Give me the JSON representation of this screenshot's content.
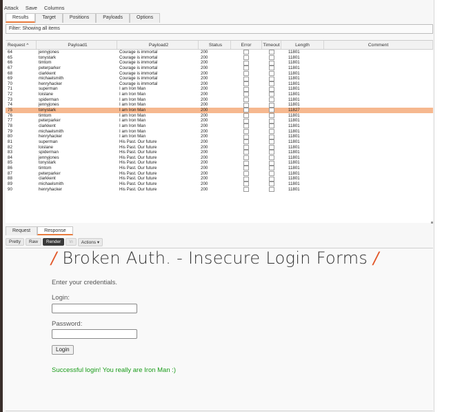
{
  "menu": [
    "Attack",
    "Save",
    "Columns"
  ],
  "tabs": [
    {
      "label": "Results",
      "active": true
    },
    {
      "label": "Target",
      "active": false
    },
    {
      "label": "Positions",
      "active": false
    },
    {
      "label": "Payloads",
      "active": false
    },
    {
      "label": "Options",
      "active": false
    }
  ],
  "filter_text": "Filter: Showing all items",
  "table": {
    "columns": [
      "Request ^",
      "Payload1",
      "Payload2",
      "Status",
      "Error",
      "Timeout",
      "Length",
      "Comment"
    ],
    "highlight_request": "75",
    "rows": [
      {
        "req": "64",
        "p1": "jennyjones",
        "p2": "Courage is immortal",
        "status": "200",
        "length": "11801"
      },
      {
        "req": "65",
        "p1": "tonystark",
        "p2": "Courage is immortal",
        "status": "200",
        "length": "11801"
      },
      {
        "req": "66",
        "p1": "timtom",
        "p2": "Courage is immortal",
        "status": "200",
        "length": "11801"
      },
      {
        "req": "67",
        "p1": "peterparker",
        "p2": "Courage is immortal",
        "status": "200",
        "length": "11801"
      },
      {
        "req": "68",
        "p1": "clarkkent",
        "p2": "Courage is immortal",
        "status": "200",
        "length": "11801"
      },
      {
        "req": "69",
        "p1": "michaelsmith",
        "p2": "Courage is immortal",
        "status": "200",
        "length": "11801"
      },
      {
        "req": "70",
        "p1": "henryhacker",
        "p2": "Courage is immortal",
        "status": "200",
        "length": "11801"
      },
      {
        "req": "71",
        "p1": "superman",
        "p2": "I am Iron Man",
        "status": "200",
        "length": "11801"
      },
      {
        "req": "72",
        "p1": "loislane",
        "p2": "I am Iron Man",
        "status": "200",
        "length": "11801"
      },
      {
        "req": "73",
        "p1": "spiderman",
        "p2": "I am Iron Man",
        "status": "200",
        "length": "11801"
      },
      {
        "req": "74",
        "p1": "jennyjones",
        "p2": "I am Iron Man",
        "status": "200",
        "length": "11801"
      },
      {
        "req": "75",
        "p1": "tonystark",
        "p2": "I am Iron Man",
        "status": "200",
        "length": "11827"
      },
      {
        "req": "76",
        "p1": "timtom",
        "p2": "I am Iron Man",
        "status": "200",
        "length": "11801"
      },
      {
        "req": "77",
        "p1": "peterparker",
        "p2": "I am Iron Man",
        "status": "200",
        "length": "11801"
      },
      {
        "req": "78",
        "p1": "clarkkent",
        "p2": "I am Iron Man",
        "status": "200",
        "length": "11801"
      },
      {
        "req": "79",
        "p1": "michaelsmith",
        "p2": "I am Iron Man",
        "status": "200",
        "length": "11801"
      },
      {
        "req": "80",
        "p1": "henryhacker",
        "p2": "I am Iron Man",
        "status": "200",
        "length": "11801"
      },
      {
        "req": "81",
        "p1": "superman",
        "p2": "His Past. Our future",
        "status": "200",
        "length": "11801"
      },
      {
        "req": "82",
        "p1": "loislane",
        "p2": "His Past. Our future",
        "status": "200",
        "length": "11801"
      },
      {
        "req": "83",
        "p1": "spiderman",
        "p2": "His Past. Our future",
        "status": "200",
        "length": "11801"
      },
      {
        "req": "84",
        "p1": "jennyjones",
        "p2": "His Past. Our future",
        "status": "200",
        "length": "11801"
      },
      {
        "req": "85",
        "p1": "tonystark",
        "p2": "His Past. Our future",
        "status": "200",
        "length": "11801"
      },
      {
        "req": "86",
        "p1": "timtom",
        "p2": "His Past. Our future",
        "status": "200",
        "length": "11801"
      },
      {
        "req": "87",
        "p1": "peterparker",
        "p2": "His Past. Our future",
        "status": "200",
        "length": "11801"
      },
      {
        "req": "88",
        "p1": "clarkkent",
        "p2": "His Past. Our future",
        "status": "200",
        "length": "11801"
      },
      {
        "req": "89",
        "p1": "michaelsmith",
        "p2": "His Past. Our future",
        "status": "200",
        "length": "11801"
      },
      {
        "req": "90",
        "p1": "henryhacker",
        "p2": "His Past. Our future",
        "status": "200",
        "length": "11801"
      }
    ]
  },
  "lower_tabs": [
    {
      "label": "Request",
      "active": false
    },
    {
      "label": "Response",
      "active": true
    }
  ],
  "toolbar": {
    "pretty": "Pretty",
    "raw": "Raw",
    "render": "Render",
    "disabled_btn": "\\n",
    "actions": "Actions ▾"
  },
  "rendered_page": {
    "heading_slash": "/",
    "heading": " Broken Auth. - Insecure Login Forms ",
    "intro": "Enter your credentials.",
    "login_label": "Login:",
    "password_label": "Password:",
    "login_button": "Login",
    "success_message": "Successful login! You really are Iron Man :)"
  },
  "colors": {
    "accent": "#e97b3d",
    "highlight_row": "#f6b88f",
    "success": "#1a9c1a",
    "heading_slash": "#e2582a"
  }
}
